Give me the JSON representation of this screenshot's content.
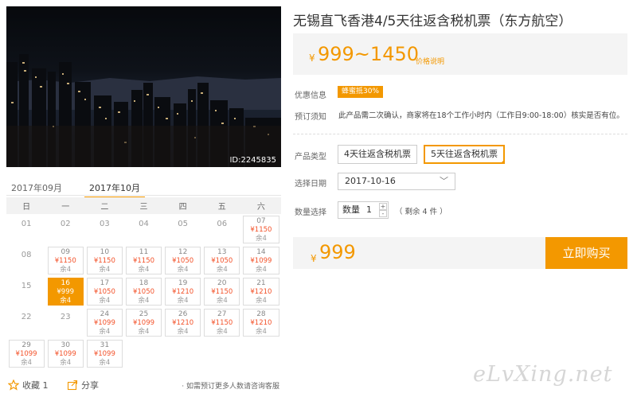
{
  "photo": {
    "id_label": "ID:2245835"
  },
  "title": "无锡直飞香港4/5天往返含税机票（东方航空）",
  "price": {
    "currency": "¥",
    "range": "999~1450",
    "note": "价格说明"
  },
  "promo": {
    "label": "优惠信息",
    "badge": "蜂蜜抵30%"
  },
  "notice": {
    "label": "预订须知",
    "text": "此产品需二次确认，商家将在18个工作小时内（工作日9:00-18:00）核实是否有位。"
  },
  "product_type": {
    "label": "产品类型",
    "options": [
      "4天往返含税机票",
      "5天往返含税机票"
    ],
    "selected": "5天往返含税机票"
  },
  "date": {
    "label": "选择日期",
    "value": "2017-10-16",
    "arrow": "chevron-down-icon"
  },
  "quantity": {
    "label": "数量选择",
    "prefix": "数量",
    "value": "1",
    "up": "+",
    "down": "-",
    "remaining": "（ 剩余 4 件 ）"
  },
  "total": {
    "currency": "¥",
    "amount": "999"
  },
  "buy_button": "立即购买",
  "months": [
    "2017年09月",
    "2017年10月"
  ],
  "active_month": "2017年10月",
  "weekdays": [
    "日",
    "一",
    "二",
    "三",
    "四",
    "五",
    "六"
  ],
  "calendar": [
    [
      {
        "d": "01"
      },
      {
        "d": "02"
      },
      {
        "d": "03"
      },
      {
        "d": "04"
      },
      {
        "d": "05"
      },
      {
        "d": "06"
      },
      {
        "d": "07",
        "p": "¥1150",
        "r": "余4"
      }
    ],
    [
      {
        "d": "08"
      },
      {
        "d": "09",
        "p": "¥1150",
        "r": "余4"
      },
      {
        "d": "10",
        "p": "¥1150",
        "r": "余4"
      },
      {
        "d": "11",
        "p": "¥1150",
        "r": "余4"
      },
      {
        "d": "12",
        "p": "¥1050",
        "r": "余4"
      },
      {
        "d": "13",
        "p": "¥1050",
        "r": "余4"
      },
      {
        "d": "14",
        "p": "¥1099",
        "r": "余4"
      }
    ],
    [
      {
        "d": "15"
      },
      {
        "d": "16",
        "p": "¥999",
        "r": "余4",
        "sel": true
      },
      {
        "d": "17",
        "p": "¥1050",
        "r": "余4"
      },
      {
        "d": "18",
        "p": "¥1050",
        "r": "余4"
      },
      {
        "d": "19",
        "p": "¥1210",
        "r": "余4"
      },
      {
        "d": "20",
        "p": "¥1150",
        "r": "余4"
      },
      {
        "d": "21",
        "p": "¥1210",
        "r": "余4"
      }
    ],
    [
      {
        "d": "22"
      },
      {
        "d": "23"
      },
      {
        "d": "24",
        "p": "¥1099",
        "r": "余4"
      },
      {
        "d": "25",
        "p": "¥1099",
        "r": "余4"
      },
      {
        "d": "26",
        "p": "¥1210",
        "r": "余4"
      },
      {
        "d": "27",
        "p": "¥1150",
        "r": "余4"
      },
      {
        "d": "28",
        "p": "¥1210",
        "r": "余4"
      }
    ],
    [
      {
        "d": "29",
        "p": "¥1099",
        "r": "余4"
      },
      {
        "d": "30",
        "p": "¥1099",
        "r": "余4"
      },
      {
        "d": "31",
        "p": "¥1099",
        "r": "余4"
      },
      null,
      null,
      null,
      null
    ]
  ],
  "footer": {
    "favorite": "收藏 1",
    "share": "分享",
    "help": "· 如需预订更多人数请咨询客服"
  },
  "watermark": "eLvXing.net",
  "colors": {
    "accent": "#f39800",
    "price_red": "#f3522a"
  }
}
